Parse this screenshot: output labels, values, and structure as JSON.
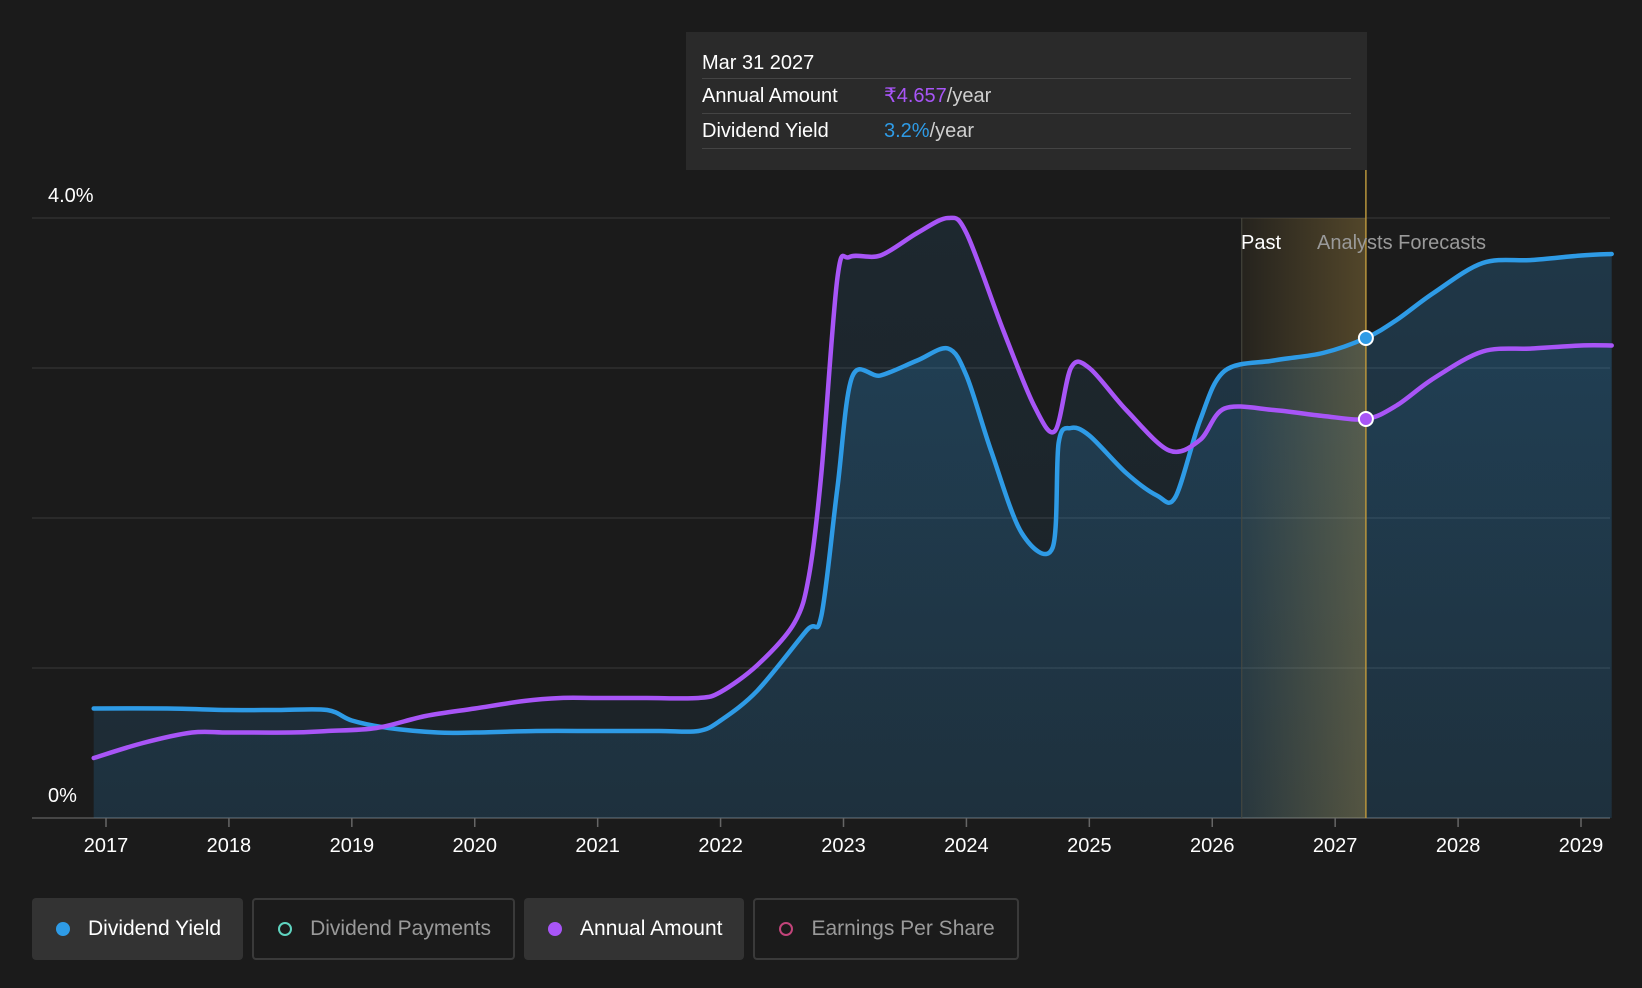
{
  "tooltip": {
    "date": "Mar 31 2027",
    "rows": [
      {
        "label": "Annual Amount",
        "value": "₹4.657",
        "unit": "/year"
      },
      {
        "label": "Dividend Yield",
        "value": "3.2%",
        "unit": "/year"
      }
    ]
  },
  "legend": [
    {
      "label": "Dividend Yield",
      "active": true,
      "color": "#2e9be6"
    },
    {
      "label": "Dividend Payments",
      "active": false,
      "color": "#5fd4c0"
    },
    {
      "label": "Annual Amount",
      "active": true,
      "color": "#a855f7"
    },
    {
      "label": "Earnings Per Share",
      "active": false,
      "color": "#c2447a"
    }
  ],
  "chart_data": {
    "type": "line",
    "y_tick_labels": [
      "4.0%",
      "0%"
    ],
    "ylim": [
      0,
      4.0
    ],
    "y_gridlines": [
      0,
      1.0,
      2.0,
      3.0,
      4.0
    ],
    "xlim": [
      2016.9,
      2029.25
    ],
    "x_ticks": [
      2017,
      2018,
      2019,
      2020,
      2021,
      2022,
      2023,
      2024,
      2025,
      2026,
      2027,
      2028,
      2029
    ],
    "x_tick_labels": [
      "2017",
      "2018",
      "2019",
      "2020",
      "2021",
      "2022",
      "2023",
      "2024",
      "2025",
      "2026",
      "2027",
      "2028",
      "2029"
    ],
    "past_label": "Past",
    "forecast_label": "Analysts Forecasts",
    "past_end": 2026.24,
    "cursor_date": 2027.25,
    "colors": {
      "yield": "#2e9be6",
      "annual": "#a855f7",
      "highlight": "#c8a24a"
    },
    "series": [
      {
        "name": "Dividend Yield",
        "key": "yield",
        "x": [
          2016.9,
          2017.5,
          2018.0,
          2018.4,
          2018.8,
          2019.0,
          2019.3,
          2019.7,
          2020.0,
          2020.5,
          2021.0,
          2021.5,
          2021.82,
          2022.0,
          2022.3,
          2022.7,
          2022.82,
          2022.95,
          2023.07,
          2023.3,
          2023.6,
          2023.85,
          2024.0,
          2024.2,
          2024.45,
          2024.7,
          2024.75,
          2024.85,
          2025.0,
          2025.3,
          2025.55,
          2025.7,
          2025.9,
          2026.1,
          2026.5,
          2026.9,
          2027.25,
          2027.5,
          2027.8,
          2028.2,
          2028.6,
          2029.0,
          2029.25
        ],
        "values": [
          0.73,
          0.73,
          0.72,
          0.72,
          0.72,
          0.65,
          0.6,
          0.57,
          0.57,
          0.58,
          0.58,
          0.58,
          0.58,
          0.65,
          0.85,
          1.25,
          1.35,
          2.2,
          2.94,
          2.95,
          3.05,
          3.13,
          2.95,
          2.45,
          1.9,
          1.8,
          2.5,
          2.6,
          2.55,
          2.3,
          2.15,
          2.14,
          2.65,
          2.98,
          3.05,
          3.1,
          3.2,
          3.32,
          3.5,
          3.7,
          3.72,
          3.75,
          3.76
        ]
      },
      {
        "name": "Annual Amount",
        "key": "annual",
        "x": [
          2016.9,
          2017.3,
          2017.7,
          2018.0,
          2018.5,
          2018.8,
          2019.2,
          2019.6,
          2020.0,
          2020.4,
          2020.7,
          2021.0,
          2021.4,
          2021.82,
          2022.0,
          2022.3,
          2022.6,
          2022.72,
          2022.82,
          2022.95,
          2023.05,
          2023.3,
          2023.6,
          2023.85,
          2024.0,
          2024.3,
          2024.55,
          2024.72,
          2024.85,
          2025.0,
          2025.3,
          2025.65,
          2025.9,
          2026.1,
          2026.5,
          2026.9,
          2027.25,
          2027.5,
          2027.8,
          2028.2,
          2028.6,
          2029.0,
          2029.25
        ],
        "values": [
          0.4,
          0.5,
          0.57,
          0.57,
          0.57,
          0.58,
          0.6,
          0.68,
          0.73,
          0.78,
          0.8,
          0.8,
          0.8,
          0.8,
          0.84,
          1.02,
          1.3,
          1.62,
          2.3,
          3.6,
          3.74,
          3.75,
          3.9,
          4.0,
          3.9,
          3.25,
          2.75,
          2.58,
          3.0,
          3.0,
          2.72,
          2.45,
          2.52,
          2.73,
          2.72,
          2.68,
          2.66,
          2.75,
          2.93,
          3.11,
          3.13,
          3.15,
          3.15
        ]
      }
    ]
  }
}
